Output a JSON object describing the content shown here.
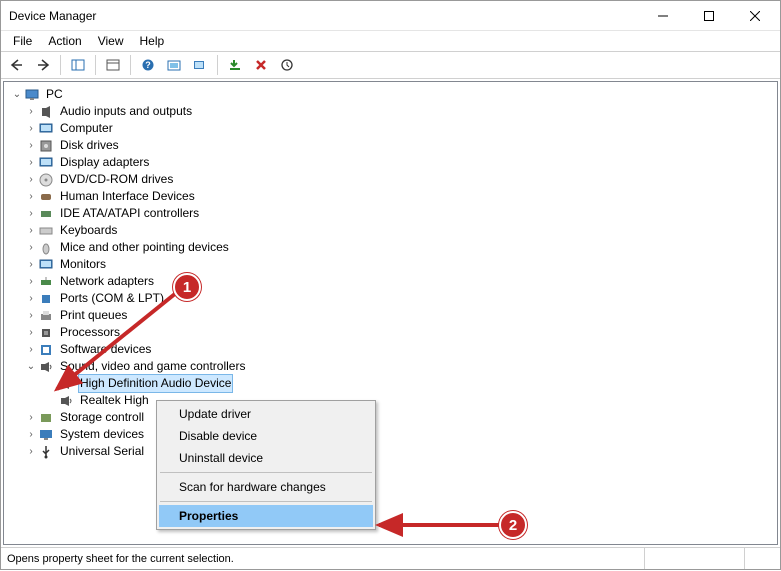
{
  "window": {
    "title": "Device Manager",
    "menus": [
      "File",
      "Action",
      "View",
      "Help"
    ]
  },
  "toolbar_buttons": [
    {
      "name": "back-icon"
    },
    {
      "name": "forward-icon"
    },
    {
      "name": "show-hide-tree-icon"
    },
    {
      "name": "properties-icon"
    },
    {
      "name": "help-icon"
    },
    {
      "name": "update-driver-icon"
    },
    {
      "name": "scan-hardware-icon"
    },
    {
      "name": "add-icon"
    },
    {
      "name": "remove-icon"
    },
    {
      "name": "enable-disable-icon"
    }
  ],
  "tree": {
    "root": "PC",
    "categories": [
      {
        "label": "Audio inputs and outputs",
        "icon": "speaker"
      },
      {
        "label": "Computer",
        "icon": "monitor"
      },
      {
        "label": "Disk drives",
        "icon": "disk"
      },
      {
        "label": "Display adapters",
        "icon": "monitor"
      },
      {
        "label": "DVD/CD-ROM drives",
        "icon": "cd"
      },
      {
        "label": "Human Interface Devices",
        "icon": "hid"
      },
      {
        "label": "IDE ATA/ATAPI controllers",
        "icon": "ide"
      },
      {
        "label": "Keyboards",
        "icon": "keyboard"
      },
      {
        "label": "Mice and other pointing devices",
        "icon": "mouse"
      },
      {
        "label": "Monitors",
        "icon": "monitor"
      },
      {
        "label": "Network adapters",
        "icon": "net"
      },
      {
        "label": "Ports (COM & LPT)",
        "icon": "port"
      },
      {
        "label": "Print queues",
        "icon": "printer"
      },
      {
        "label": "Processors",
        "icon": "cpu"
      },
      {
        "label": "Software devices",
        "icon": "software"
      },
      {
        "label": "Sound, video and game controllers",
        "icon": "sound",
        "expanded": true,
        "children": [
          {
            "label": "High Definition Audio Device",
            "selected": true
          },
          {
            "label": "Realtek High"
          }
        ]
      },
      {
        "label": "Storage controll",
        "icon": "storage"
      },
      {
        "label": "System devices",
        "icon": "system"
      },
      {
        "label": "Universal Serial",
        "icon": "usb"
      }
    ]
  },
  "context_menu": {
    "items": [
      {
        "label": "Update driver"
      },
      {
        "label": "Disable device"
      },
      {
        "label": "Uninstall device"
      },
      {
        "sep": true
      },
      {
        "label": "Scan for hardware changes"
      },
      {
        "sep": true
      },
      {
        "label": "Properties",
        "highlighted": true
      }
    ]
  },
  "statusbar": {
    "text": "Opens property sheet for the current selection."
  },
  "annotations": {
    "badge1": "1",
    "badge2": "2"
  }
}
